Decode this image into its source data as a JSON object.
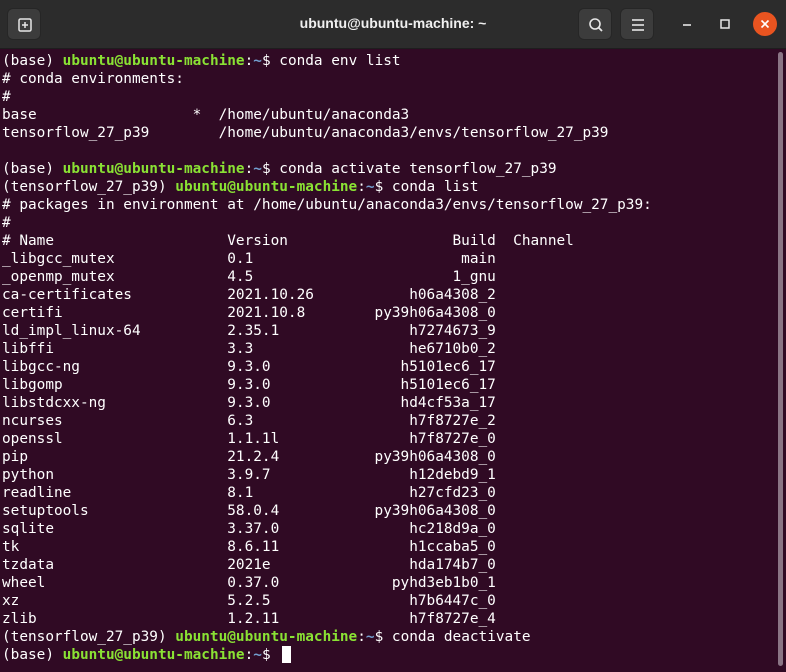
{
  "window": {
    "title": "ubuntu@ubuntu-machine: ~",
    "new_tab_icon": "new-tab-icon",
    "search_icon": "search-icon",
    "menu_icon": "hamburger-menu-icon",
    "minimize_icon": "minimize-icon",
    "maximize_icon": "maximize-icon",
    "close_icon": "close-icon",
    "accent_color": "#e95420"
  },
  "colors": {
    "background": "#300a24",
    "text": "#ffffff",
    "prompt_user": "#8ae234",
    "prompt_path": "#729fcf"
  },
  "prompt": {
    "base_env": "(base) ",
    "tf_env": "(tensorflow_27_p39) ",
    "userhost": "ubuntu@ubuntu-machine",
    "colon": ":",
    "path": "~",
    "dollar": "$ "
  },
  "commands": {
    "env_list": "conda env list",
    "activate": "conda activate tensorflow_27_p39",
    "list": "conda list",
    "deactivate": "conda deactivate"
  },
  "env_output": [
    "# conda environments:",
    "#",
    "base                  *  /home/ubuntu/anaconda3",
    "tensorflow_27_p39        /home/ubuntu/anaconda3/envs/tensorflow_27_p39",
    ""
  ],
  "list_output": [
    "# packages in environment at /home/ubuntu/anaconda3/envs/tensorflow_27_p39:",
    "#",
    "# Name                    Version                   Build  Channel",
    "_libgcc_mutex             0.1                        main",
    "_openmp_mutex             4.5                       1_gnu",
    "ca-certificates           2021.10.26           h06a4308_2",
    "certifi                   2021.10.8        py39h06a4308_0",
    "ld_impl_linux-64          2.35.1               h7274673_9",
    "libffi                    3.3                  he6710b0_2",
    "libgcc-ng                 9.3.0               h5101ec6_17",
    "libgomp                   9.3.0               h5101ec6_17",
    "libstdcxx-ng              9.3.0               hd4cf53a_17",
    "ncurses                   6.3                  h7f8727e_2",
    "openssl                   1.1.1l               h7f8727e_0",
    "pip                       21.2.4           py39h06a4308_0",
    "python                    3.9.7                h12debd9_1",
    "readline                  8.1                  h27cfd23_0",
    "setuptools                58.0.4           py39h06a4308_0",
    "sqlite                    3.37.0               hc218d9a_0",
    "tk                        8.6.11               h1ccaba5_0",
    "tzdata                    2021e                hda174b7_0",
    "wheel                     0.37.0             pyhd3eb1b0_1",
    "xz                        5.2.5                h7b6447c_0",
    "zlib                      1.2.11               h7f8727e_4"
  ]
}
